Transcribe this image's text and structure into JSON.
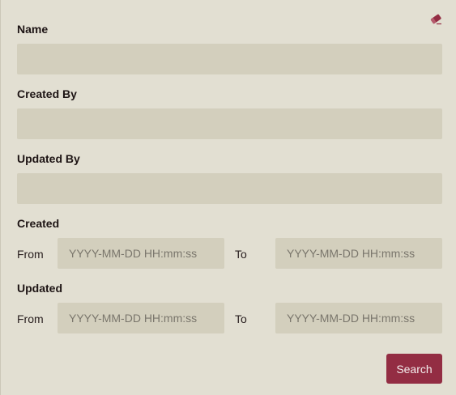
{
  "icons": {
    "clear": "eraser-icon"
  },
  "colors": {
    "background": "#e2dfd2",
    "input_background": "#d3cfbd",
    "accent": "#932d43"
  },
  "fields": {
    "name": {
      "label": "Name",
      "value": ""
    },
    "created_by": {
      "label": "Created By",
      "value": ""
    },
    "updated_by": {
      "label": "Updated By",
      "value": ""
    }
  },
  "created": {
    "label": "Created",
    "from_label": "From",
    "to_label": "To",
    "from_placeholder": "YYYY-MM-DD HH:mm:ss",
    "to_placeholder": "YYYY-MM-DD HH:mm:ss"
  },
  "updated": {
    "label": "Updated",
    "from_label": "From",
    "to_label": "To",
    "from_placeholder": "YYYY-MM-DD HH:mm:ss",
    "to_placeholder": "YYYY-MM-DD HH:mm:ss"
  },
  "actions": {
    "search_label": "Search"
  }
}
